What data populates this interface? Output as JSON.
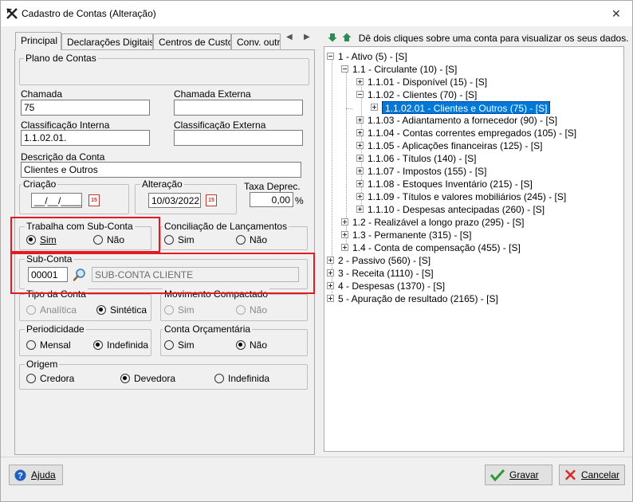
{
  "window": {
    "title": "Cadastro de Contas (Alteração)",
    "close_glyph": "✕"
  },
  "tabs": [
    "Principal",
    "Declarações Digitais",
    "Centros de Custo",
    "Conv. outra"
  ],
  "form": {
    "plano_contas_label": "Plano de Contas",
    "chamada_label": "Chamada",
    "chamada_value": "75",
    "chamada_externa_label": "Chamada Externa",
    "chamada_externa_value": "",
    "class_interna_label": "Classificação Interna",
    "class_interna_value": "1.1.02.01.",
    "class_externa_label": "Classificação Externa",
    "class_externa_value": "",
    "descricao_label": "Descrição da Conta",
    "descricao_value": "Clientes e Outros",
    "criacao_label": "Criação",
    "criacao_value": "__/__/____",
    "alteracao_label": "Alteração",
    "alteracao_value": "10/03/2022",
    "taxa_label": "Taxa Deprec.",
    "taxa_value": "0,00",
    "taxa_unit": "%",
    "subconta_group": "Trabalha com Sub-Conta",
    "subconta_sim": "Sim",
    "subconta_nao": "Não",
    "conciliacao_group": "Conciliação de Lançamentos",
    "conciliacao_sim": "Sim",
    "conciliacao_nao": "Não",
    "subconta_label": "Sub-Conta",
    "subconta_code": "00001",
    "subconta_desc": "SUB-CONTA CLIENTE",
    "tipo_group": "Tipo da Conta",
    "tipo_analitica": "Analítica",
    "tipo_sintetica": "Sintética",
    "movimento_group": "Movimento Compactado",
    "movimento_sim": "Sim",
    "movimento_nao": "Não",
    "periodicidade_group": "Periodicidade",
    "periodicidade_mensal": "Mensal",
    "periodicidade_indefinida": "Indefinida",
    "orcamentaria_group": "Conta Orçamentária",
    "orcamentaria_sim": "Sim",
    "orcamentaria_nao": "Não",
    "origem_group": "Origem",
    "origem_credora": "Credora",
    "origem_devedora": "Devedora",
    "origem_indefinida": "Indefinida",
    "calendar_glyph": "15"
  },
  "tree": {
    "hint": "Dê dois cliques sobre uma conta para visualizar os seus dados.",
    "nodes": [
      "1 - Ativo (5) - [S]",
      "1.1 - Circulante (10) - [S]",
      "1.1.01 - Disponível (15) - [S]",
      "1.1.02 - Clientes (70) - [S]",
      "1.1.02.01 - Clientes e Outros (75) - [S]",
      "1.1.03 - Adiantamento a fornecedor (90) - [S]",
      "1.1.04 - Contas correntes empregados (105) - [S]",
      "1.1.05 - Aplicações financeiras (125) - [S]",
      "1.1.06 - Títulos (140) - [S]",
      "1.1.07 - Impostos (155) - [S]",
      "1.1.08 - Estoques Inventário (215) - [S]",
      "1.1.09 - Títulos e valores mobiliários (245) - [S]",
      "1.1.10 - Despesas antecipadas (260) - [S]",
      "1.2 - Realizável a longo prazo (295) - [S]",
      "1.3 - Permanente (315) - [S]",
      "1.4 - Conta de compensação (455) - [S]",
      "2 - Passivo (560) - [S]",
      "3 - Receita (1110) - [S]",
      "4 - Despesas (1370) - [S]",
      "5 - Apuração de resultado (2165) - [S]"
    ]
  },
  "buttons": {
    "ajuda": "Ajuda",
    "gravar": "Gravar",
    "cancelar": "Cancelar"
  },
  "colors": {
    "highlight": "#e21b23",
    "selection": "#0078d7"
  }
}
